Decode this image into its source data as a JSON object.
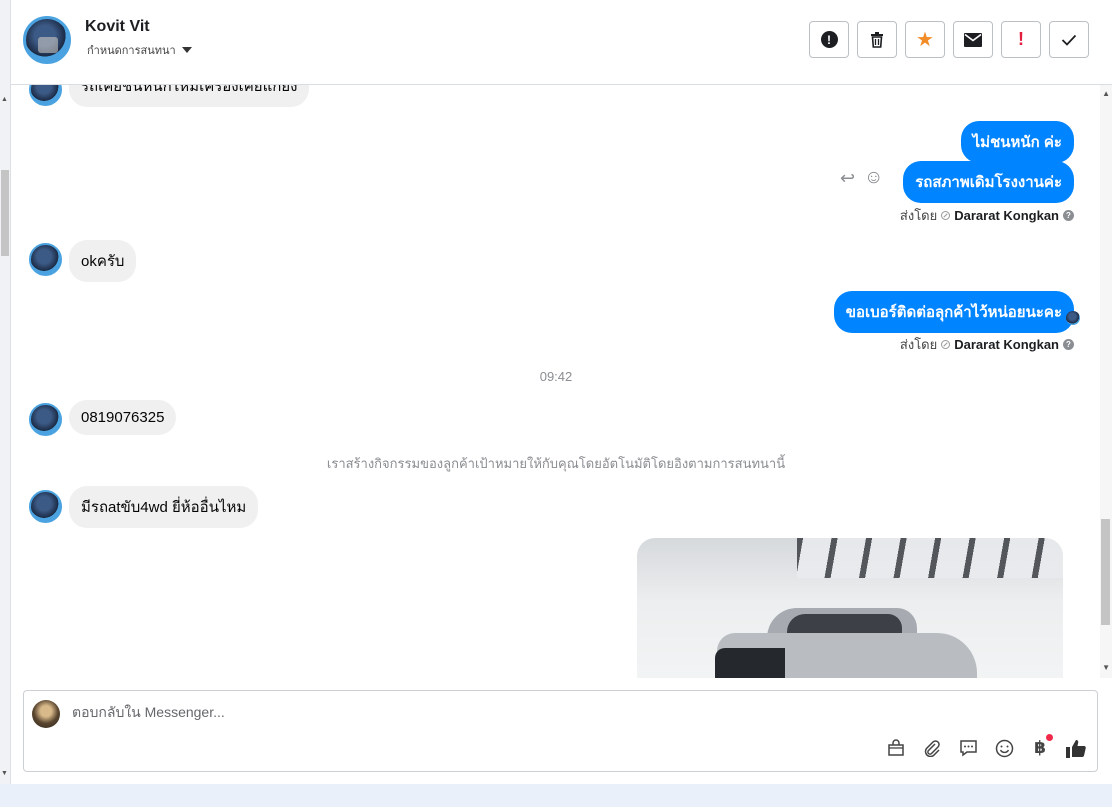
{
  "header": {
    "contact_name": "Kovit Vit",
    "assign_label": "กำหนดการสนทนา",
    "actions": [
      {
        "name": "spam-button",
        "icon": "exclamation-circle-icon",
        "glyph": "!"
      },
      {
        "name": "delete-button",
        "icon": "trash-icon",
        "glyph": "🗑"
      },
      {
        "name": "star-button",
        "icon": "star-icon",
        "glyph": "★"
      },
      {
        "name": "mark-unread-button",
        "icon": "envelope-icon",
        "glyph": "✉"
      },
      {
        "name": "follow-up-button",
        "icon": "exclamation-icon",
        "glyph": "!"
      },
      {
        "name": "done-button",
        "icon": "check-icon",
        "glyph": "✓"
      }
    ]
  },
  "messages": {
    "partial_incoming": "รถเคยชนหนักไหมเครื่องเคยแก้ยัง",
    "out_1": "ไม่ชนหนัก ค่ะ",
    "out_2": "รถสภาพเดิมโรงงานค่ะ",
    "sent_by_label": "ส่งโดย",
    "agent_name": "Dararat Kongkan",
    "in_ok": "okครับ",
    "out_3": "ขอเบอร์ติดต่อลุกค้าไว้หน่อยนะคะ",
    "time_1": "09:42",
    "in_phone": "0819076325",
    "system_note": "เราสร้างกิจกรรมของลูกค้าเป้าหมายให้กับคุณโดยอัตโนมัติโดยอิงตามการสนทนานี้",
    "in_question": "มีรถatขับ4wd ยี่ห้ออื่นไหม"
  },
  "composer": {
    "placeholder": "ตอบกลับใน Messenger...",
    "tools": [
      {
        "name": "shop-icon",
        "glyph": "⛀"
      },
      {
        "name": "attach-icon",
        "glyph": "📎"
      },
      {
        "name": "saved-reply-icon",
        "glyph": "💬"
      },
      {
        "name": "emoji-icon",
        "glyph": "☺"
      },
      {
        "name": "baht-payment-icon",
        "glyph": "฿"
      },
      {
        "name": "like-icon",
        "glyph": "👍"
      }
    ]
  },
  "colors": {
    "outgoing_bubble": "#0084ff",
    "incoming_bubble": "#f0f0f0",
    "star": "#f28c28",
    "alert": "#e41e3f"
  }
}
